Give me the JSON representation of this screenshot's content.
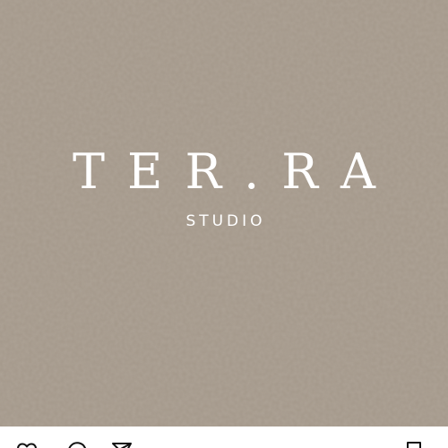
{
  "post": {
    "brand": {
      "name": "TER.RA",
      "tagline": "STUDIO"
    },
    "background_color": "#a4988a",
    "text_color": "#ffffff"
  },
  "action_bar": {
    "icons": [
      "heart-icon",
      "comment-icon",
      "share-icon",
      "bookmark-icon"
    ]
  }
}
